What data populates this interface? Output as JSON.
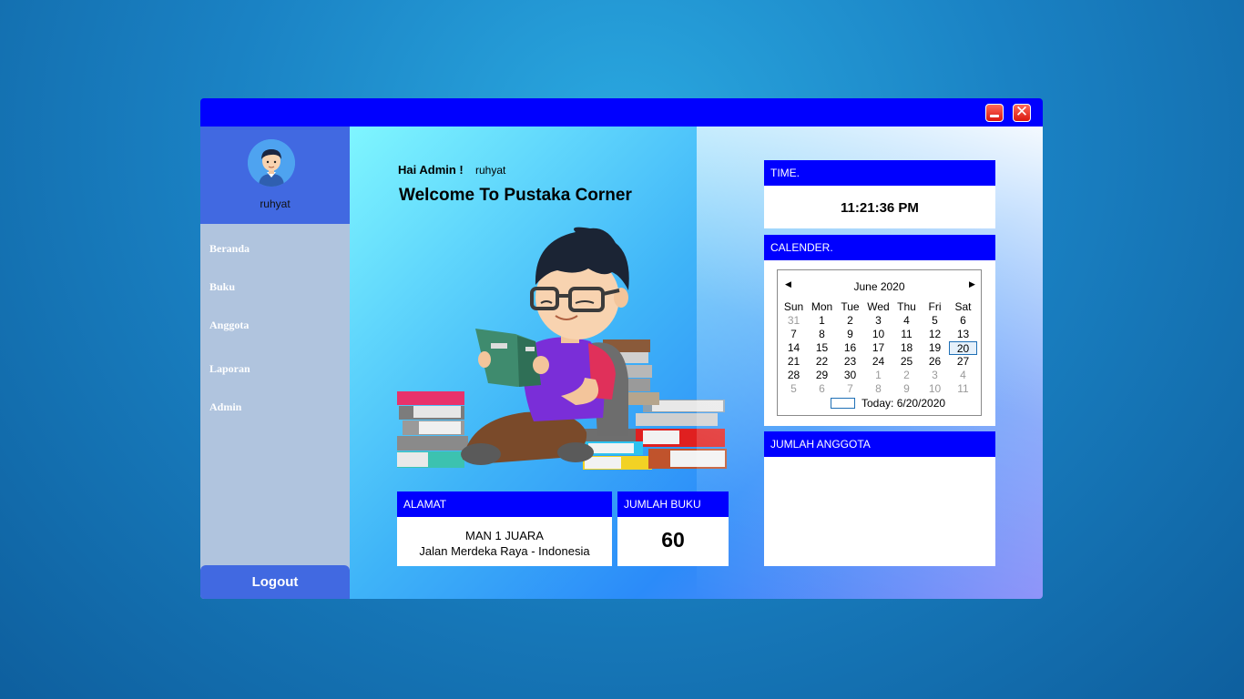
{
  "window": {
    "controls": [
      "minimize-icon",
      "close-icon"
    ]
  },
  "profile": {
    "name": "ruhyat",
    "icon": "user-avatar-icon"
  },
  "nav": [
    {
      "label": "Beranda"
    },
    {
      "label": "Buku"
    },
    {
      "label": "Anggota"
    },
    {
      "label": "Laporan"
    },
    {
      "label": "Admin"
    }
  ],
  "logout_label": "Logout",
  "greeting": {
    "hi": "Hai Admin !",
    "user": "ruhyat",
    "welcome": "Welcome To Pustaka Corner"
  },
  "illustration": "student-reading-book-icon",
  "alamat": {
    "header": "ALAMAT",
    "line1": "MAN 1 JUARA",
    "line2": "Jalan Merdeka Raya - Indonesia"
  },
  "jumlah_buku": {
    "header": "JUMLAH BUKU",
    "value": "60"
  },
  "time": {
    "header": "TIME.",
    "value": "11:21:36 PM"
  },
  "calendar": {
    "header": "CALENDER.",
    "month": "June 2020",
    "days": [
      "Sun",
      "Mon",
      "Tue",
      "Wed",
      "Thu",
      "Fri",
      "Sat"
    ],
    "weeks": [
      [
        "31",
        "1",
        "2",
        "3",
        "4",
        "5",
        "6"
      ],
      [
        "7",
        "8",
        "9",
        "10",
        "11",
        "12",
        "13"
      ],
      [
        "14",
        "15",
        "16",
        "17",
        "18",
        "19",
        "20"
      ],
      [
        "21",
        "22",
        "23",
        "24",
        "25",
        "26",
        "27"
      ],
      [
        "28",
        "29",
        "30",
        "1",
        "2",
        "3",
        "4"
      ],
      [
        "5",
        "6",
        "7",
        "8",
        "9",
        "10",
        "11"
      ]
    ],
    "selected": "20",
    "today_label": "Today: 6/20/2020"
  },
  "jumlah_anggota": {
    "header": "JUMLAH ANGGOTA"
  },
  "colors": {
    "titlebar": "#0000ff",
    "sidebar": "#b0c4de",
    "profile": "#4169e1",
    "card_header": "#0000ff"
  }
}
